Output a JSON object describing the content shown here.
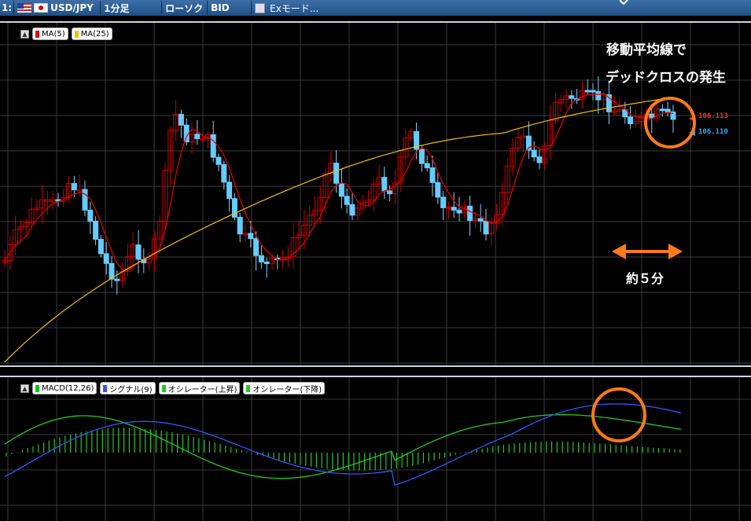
{
  "toolbar": {
    "pane_number": "1:",
    "pair": "USD/JPY",
    "timeframe": "1分足",
    "chart_style": "ローソク",
    "price_type": "BID",
    "ex_mode": "Exモード..."
  },
  "main_chart": {
    "legend": [
      {
        "label": "MA(5)",
        "color": "#e00000"
      },
      {
        "label": "MA(25)",
        "color": "#f0c000"
      }
    ],
    "price_tags": {
      "ma5": "106.113",
      "price": "106.110"
    },
    "annotation_line1": "移動平均線で",
    "annotation_line2": "デッドクロスの発生",
    "arrow_label": "約５分"
  },
  "sub_chart": {
    "legend": [
      {
        "label": "MACD(12,26)",
        "color": "#00cc00"
      },
      {
        "label": "シグナル(9)",
        "color": "#3355ff"
      },
      {
        "label": "オシレーター(上昇)",
        "color": "#22cc22"
      },
      {
        "label": "オシレーター(下降)",
        "color": "#22cc22"
      }
    ]
  },
  "chart_data": [
    {
      "type": "candlestick",
      "title": "",
      "up_color": "#cc0000",
      "down_color": "#66ccff",
      "ma5_color": "#e00000",
      "ma25_color": "#f0c000",
      "grid": true,
      "series": [
        {
          "name": "MA(5)",
          "last": 106.113
        },
        {
          "name": "MA(25)"
        }
      ]
    },
    {
      "type": "line",
      "title": "",
      "series": [
        {
          "name": "MACD(12,26)",
          "color": "#22cc22"
        },
        {
          "name": "シグナル(9)",
          "color": "#3355ff"
        },
        {
          "name": "オシレーター(上昇)",
          "color": "#22cc22"
        },
        {
          "name": "オシレーター(下降)",
          "color": "#22cc22"
        }
      ],
      "grid": true
    }
  ]
}
